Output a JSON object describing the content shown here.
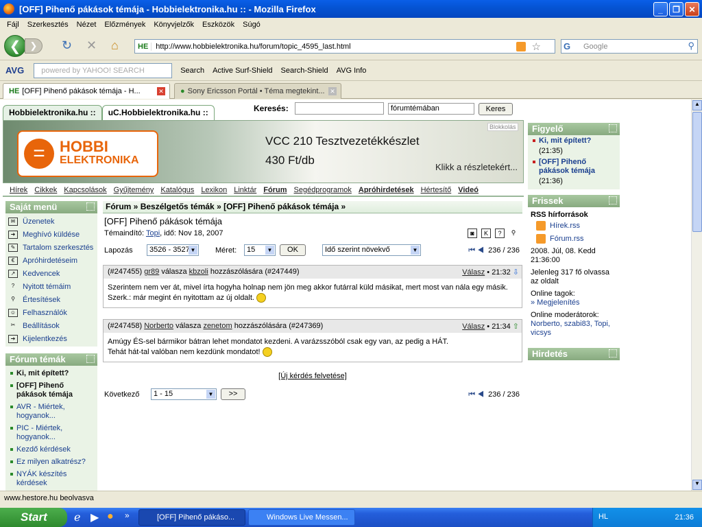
{
  "window": {
    "title": "[OFF] Pihenő pákások témája - Hobbielektronika.hu :: - Mozilla Firefox"
  },
  "menu": [
    "Fájl",
    "Szerkesztés",
    "Nézet",
    "Előzmények",
    "Könyvjelzők",
    "Eszközök",
    "Súgó"
  ],
  "address": {
    "prefix": "HE",
    "url": "http://www.hobbielektronika.hu/forum/topic_4595_last.html",
    "search_placeholder": "Google"
  },
  "toolbar2": {
    "avg": "AVG",
    "yahoo": "powered by YAHOO! SEARCH",
    "search": "Search",
    "surf": "Active Surf-Shield",
    "ssearch": "Search-Shield",
    "info": "AVG Info"
  },
  "tabs": [
    {
      "label": "[OFF] Pihenő pákások témája - H..."
    },
    {
      "label": "Sony Ericsson Portál • Téma megtekint..."
    }
  ],
  "site": {
    "tabs": [
      "Hobbielektronika.hu ::",
      "uC.Hobbielektronika.hu ::"
    ],
    "search_label": "Keresés:",
    "search_scope": "fórumtémában",
    "search_button": "Keres",
    "banner": {
      "blokk": "Blokkolás",
      "title": "VCC 210 Tesztvezetékkészlet",
      "price": "430 Ft/db",
      "cta": "Klikk a részletekért...",
      "logo1": "HOBBI",
      "logo2": "ELEKTRONIKA"
    },
    "nav": [
      "Hírek",
      "Cikkek",
      "Kapcsolások",
      "Gyűjtemény",
      "Katalógus",
      "Lexikon",
      "Linktár",
      "Fórum",
      "Segédprogramok",
      "Apróhirdetések",
      "Hértesítő",
      "Videó"
    ]
  },
  "left": {
    "menu_title": "Saját menü",
    "menu": [
      "Üzenetek",
      "Meghívó küldése",
      "Tartalom szerkesztés",
      "Apróhirdetéseim",
      "Kedvencek",
      "Nyitott témáim",
      "Értesítések",
      "Felhasználók",
      "Beállítások",
      "Kijelentkezés"
    ],
    "topics_title": "Fórum témák",
    "topics": [
      "Ki, mit épített?",
      "[OFF] Pihenő pákások témája",
      "AVR - Miértek, hogyanok...",
      "PIC - Miértek, hogyanok...",
      "Kezdő kérdések",
      "Ez milyen alkatrész?",
      "NYÁK készítés kérdések"
    ]
  },
  "main": {
    "crumb": [
      "Fórum",
      "Beszélgetős témák",
      "[OFF] Pihenő pákások témája"
    ],
    "title": "[OFF] Pihenő pákások témája",
    "meta_prefix": "Témaindító:",
    "meta_author": "Topi",
    "meta_suffix": ", idő: Nov 18, 2007",
    "lapozas": "Lapozás",
    "page_range": "3526 - 3527",
    "meret_label": "Méret:",
    "meret": "15",
    "ok": "OK",
    "order": "Idő szerint növekvő",
    "pager": "236 / 236",
    "posts": [
      {
        "id": "(#247455)",
        "user": "gr89",
        "mid": "válasza",
        "reply_to": "kbzoli",
        "suffix": "hozzászólására (#247449)",
        "reply": "Válasz",
        "time": "• 21:32",
        "body1": "Szerintem nem ver át, mivel írta hogyha holnap nem jön meg akkor futárral küld másikat, mert most van nála egy másik.",
        "body2": "Szerk.: már megint én nyitottam az új oldalt."
      },
      {
        "id": "(#247458)",
        "user": "Norberto",
        "mid": "válasza",
        "reply_to": "zenetom",
        "suffix": "hozzászólására (#247369)",
        "reply": "Válasz",
        "time": "• 21:34",
        "body1": "Amúgy ÉS-sel bármikor bátran lehet mondatot kezdeni. A varázsszóból csak egy van, az pedig a HÁT.",
        "body2": "Tehát hát-tal valóban nem kezdünk mondatot!"
      }
    ],
    "newq": "[Új kérdés felvetése]",
    "next_label": "Következő",
    "next_range": "1 - 15",
    "next_btn": ">>"
  },
  "right": {
    "figyelo_title": "Figyelő",
    "figyelo": [
      {
        "t": "Ki, mit épített?",
        "time": "(21:35)"
      },
      {
        "t": "[OFF] Pihenő pákások témája",
        "time": "(21:36)"
      }
    ],
    "frissek_title": "Frissek",
    "rss_title": "RSS hírforrások",
    "rss": [
      "Hírek.rss",
      "Fórum.rss"
    ],
    "date": "2008. Júl, 08. Kedd 21:36:00",
    "online": "Jelenleg 317 fő olvassa az oldalt",
    "members_label": "Online tagok:",
    "members_link": "» Megjelenítés",
    "mods_label": "Online moderátorok:",
    "mods": "Norberto, szabi83, Topi, vicsys",
    "hirdetes_title": "Hirdetés"
  },
  "status": "www.hestore.hu beolvasva",
  "taskbar": {
    "start": "Start",
    "task1": "[OFF] Pihenő pákáso...",
    "task2": "Windows Live Messen...",
    "lang": "HL",
    "clock": "21:36"
  }
}
